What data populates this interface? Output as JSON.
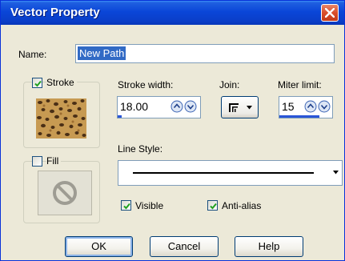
{
  "window": {
    "title": "Vector Property"
  },
  "name_field": {
    "label": "Name:",
    "value": "New Path"
  },
  "stroke": {
    "label": "Stroke",
    "checked": true,
    "texture": "leopard-print"
  },
  "stroke_width": {
    "label": "Stroke width:",
    "value": "18.00",
    "level": 0.05
  },
  "join": {
    "label": "Join:",
    "icon": "miter-join-icon"
  },
  "miter_limit": {
    "label": "Miter limit:",
    "value": "15",
    "level": 0.75
  },
  "fill": {
    "label": "Fill",
    "checked": false,
    "icon": "no-fill-icon"
  },
  "line_style": {
    "label": "Line Style:",
    "selected": "solid"
  },
  "options": {
    "visible": {
      "label": "Visible",
      "checked": true
    },
    "antialias": {
      "label": "Anti-alias",
      "checked": true
    }
  },
  "buttons": {
    "ok": "OK",
    "cancel": "Cancel",
    "help": "Help"
  },
  "colors": {
    "titlebar": "#0a46d8",
    "dialog_bg": "#ece9d8",
    "selection": "#316ac5",
    "spin_level": "#2a55d6",
    "check": "#21a121",
    "close": "#d94e2a"
  }
}
